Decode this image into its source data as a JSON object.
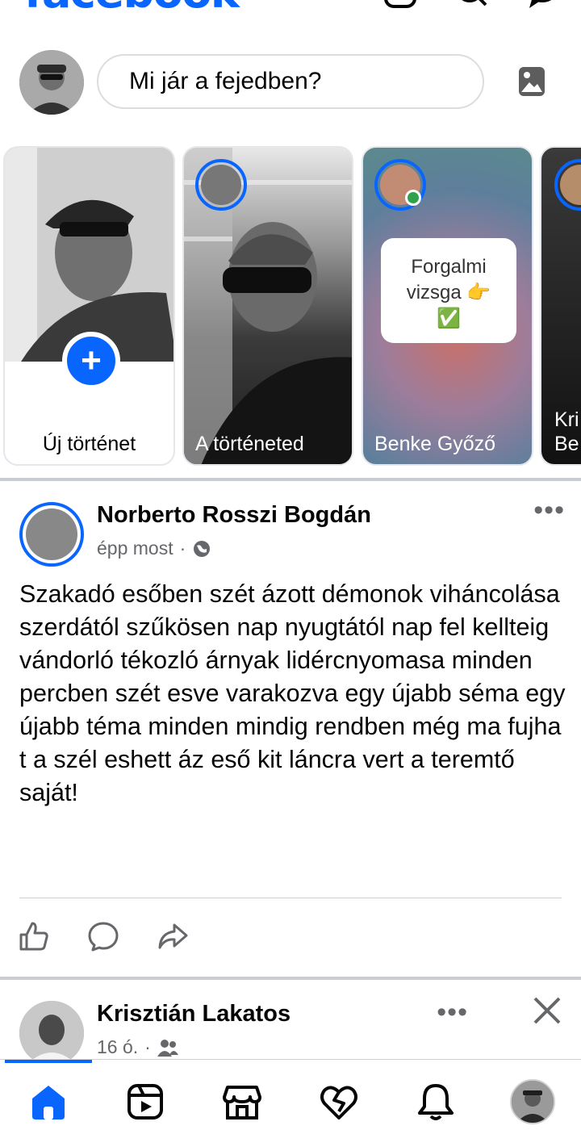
{
  "app": {
    "logo_text": "facebook",
    "brand_color": "#0866ff"
  },
  "header_icons": [
    "add-icon",
    "search-icon",
    "messenger-icon"
  ],
  "composer": {
    "placeholder": "Mi jár a fejedben?",
    "photo_icon": "photo-icon"
  },
  "stories": {
    "create_label": "Új történet",
    "items": [
      {
        "name": "A történeted"
      },
      {
        "name": "Benke Győző",
        "sticker_line1": "Forgalmi",
        "sticker_line2": "vizsga 👉",
        "sticker_line3": "✅"
      },
      {
        "name": "Kri Be"
      }
    ]
  },
  "post": {
    "author": "Norberto Rosszi Bogdán",
    "time": "épp most",
    "separator": "·",
    "audience_icon": "globe-icon",
    "more": "•••",
    "text": "Szakadó esőben szét ázott démonok viháncolása szerdától szűkösen nap nyugtától nap fel kellteig vándorló tékozló árnyak lidércnyomasa minden percben szét esve varakozva egy újabb séma egy újabb téma minden mindig rendben még ma fujha t a szél eshett áz eső kit láncra vert a teremtő saját!",
    "actions": [
      "like-icon",
      "comment-icon",
      "share-icon"
    ]
  },
  "post2": {
    "author": "Krisztián Lakatos",
    "time": "16 ó.",
    "separator": "·",
    "audience_icon": "friends-icon",
    "more": "•••"
  },
  "bottom_nav": [
    "home-icon",
    "video-icon",
    "marketplace-icon",
    "dating-icon",
    "notifications-icon",
    "profile-avatar"
  ]
}
